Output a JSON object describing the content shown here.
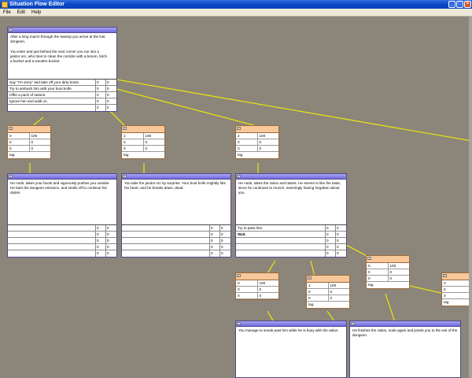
{
  "window": {
    "title": "Situation Flow Editor",
    "minimize": "_",
    "maximize": "□",
    "close": "×"
  },
  "menu": [
    "File",
    "Edit",
    "Help"
  ],
  "colors": {
    "link": "#e6e014",
    "canvas": "#8c857a",
    "situation_header": "#7a76e6",
    "option_header": "#f8c89a"
  },
  "situations": [
    {
      "text": "After a long march through the swamp you arrive at the lost dungeon.\n\nYou enter and just behind the next corner you run into a janitor orc, who tries to clean the corridor with a broom, fetch a bucket and a wooden bucket.",
      "choices": [
        {
          "text": "Say \"I'm sorry\" and take off your dirty boots.",
          "a": "0",
          "b": "0"
        },
        {
          "text": "Try to ambush him with your boot knife.",
          "a": "0",
          "b": "0"
        },
        {
          "text": "Offer a pack of rations.",
          "a": "0",
          "b": "0"
        },
        {
          "text": "Ignore him and walk on.",
          "a": "0",
          "b": "0"
        },
        {
          "text": "",
          "a": "0",
          "b": "0"
        }
      ]
    },
    {
      "text": "He nods, takes your boots and vigorously pushes you outside. He bars the dungeon entrance, and strolls off to continue his duties.",
      "choices": [
        {
          "text": "",
          "a": "0",
          "b": "0"
        },
        {
          "text": "",
          "a": "0",
          "b": "0"
        },
        {
          "text": "",
          "a": "0",
          "b": "0"
        },
        {
          "text": "",
          "a": "0",
          "b": "0"
        },
        {
          "text": "",
          "a": "0",
          "b": "0"
        }
      ]
    },
    {
      "text": "You take the janitor orc by surprise. Your boot knife mightily hits his heart, and he breaks down, dead.",
      "choices": [
        {
          "text": "",
          "a": "0",
          "b": "0"
        },
        {
          "text": "",
          "a": "0",
          "b": "0"
        },
        {
          "text": "",
          "a": "0",
          "b": "0"
        },
        {
          "text": "",
          "a": "0",
          "b": "0"
        },
        {
          "text": "",
          "a": "0",
          "b": "0"
        }
      ]
    },
    {
      "text": "He nods, takes the ration and tastes. He seems to like the taste, since he continues to munch, seemingly having forgotten about you.",
      "choices": [
        {
          "text": "Try to pass him.",
          "a": "0",
          "b": "0"
        },
        {
          "text": "Wait.",
          "a": "0",
          "b": "0"
        },
        {
          "text": "",
          "a": "0",
          "b": "0"
        },
        {
          "text": "",
          "a": "0",
          "b": "0"
        },
        {
          "text": "",
          "a": "0",
          "b": "0"
        }
      ]
    },
    {
      "text": "You manage to sneak past him while he is busy with the ration."
    },
    {
      "text": "He finishes the ration, nods again and points you to the exit of the dungeon."
    }
  ],
  "options": [
    {
      "r1": [
        "0",
        "100"
      ],
      "r2": [
        "0",
        "0"
      ],
      "r3": [
        "0",
        "0"
      ],
      "tag": "tag"
    },
    {
      "r1": [
        "1",
        "100"
      ],
      "r2": [
        "0",
        "0"
      ],
      "r3": [
        "0",
        "0"
      ],
      "tag": "tag"
    },
    {
      "r1": [
        "2",
        "100"
      ],
      "r2": [
        "0",
        "0"
      ],
      "r3": [
        "0",
        "0"
      ],
      "tag": "tag"
    },
    {
      "r1": [
        "0",
        "100"
      ],
      "r2": [
        "0",
        "0"
      ],
      "r3": [
        "0",
        "0"
      ],
      "tag": ""
    },
    {
      "r1": [
        "1",
        "100"
      ],
      "r2": [
        "0",
        "0"
      ],
      "r3": [
        "0",
        "0"
      ],
      "tag": "tag"
    },
    {
      "r1": [
        "0",
        "100"
      ],
      "r2": [
        "0",
        "0"
      ],
      "r3": [
        "0",
        "0"
      ],
      "tag": "tag"
    },
    {
      "r1": [
        "0",
        ""
      ],
      "r2": [
        "0",
        ""
      ],
      "r3": [
        "0",
        ""
      ],
      "tag": "tag"
    }
  ]
}
